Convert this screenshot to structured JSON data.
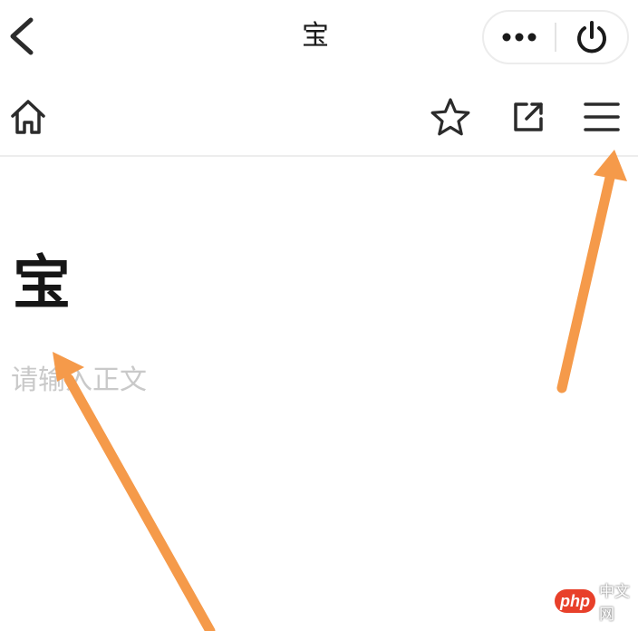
{
  "header": {
    "title": "宝",
    "back_icon": "chevron-left-icon",
    "capsule": {
      "more_icon": "more-dots-icon",
      "close_icon": "power-icon"
    }
  },
  "toolbar": {
    "home_icon": "home-icon",
    "favorite_icon": "star-icon",
    "share_icon": "share-external-icon",
    "menu_icon": "hamburger-menu-icon"
  },
  "editor": {
    "title_text": "宝",
    "body_placeholder": "请输入正文",
    "body_value": ""
  },
  "annotations": {
    "arrow_color": "#f59a4a",
    "arrows": [
      "menu-pointer",
      "title-pointer"
    ]
  },
  "watermark": {
    "badge": "php",
    "text": "中文网",
    "badge_color": "#e8402a"
  },
  "colors": {
    "text": "#1a1a1a",
    "icon": "#2b2b2b",
    "placeholder": "#c9c9c9",
    "divider": "#ededed"
  }
}
